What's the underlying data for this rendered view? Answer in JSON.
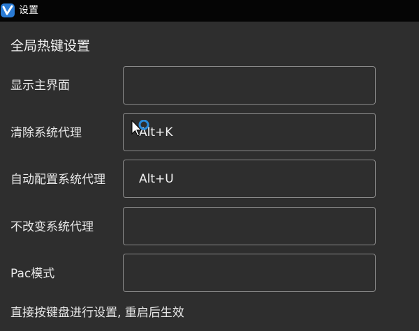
{
  "window": {
    "title": "设置",
    "icon": "v-logo-icon"
  },
  "section": {
    "title": "全局热键设置"
  },
  "hotkeys": [
    {
      "label": "显示主界面",
      "value": ""
    },
    {
      "label": "清除系统代理",
      "value": "Alt+K"
    },
    {
      "label": "自动配置系统代理",
      "value": "Alt+U"
    },
    {
      "label": "不改变系统代理",
      "value": ""
    },
    {
      "label": "Pac模式",
      "value": ""
    }
  ],
  "footer": {
    "note": "直接按键盘进行设置, 重启后生效"
  },
  "colors": {
    "titlebar_bg": "#050505",
    "content_bg": "#2e2e2e",
    "input_border": "#8a8a8a",
    "icon_accent": "#2a7bd4",
    "busy_ring": "#2a8ad8"
  }
}
